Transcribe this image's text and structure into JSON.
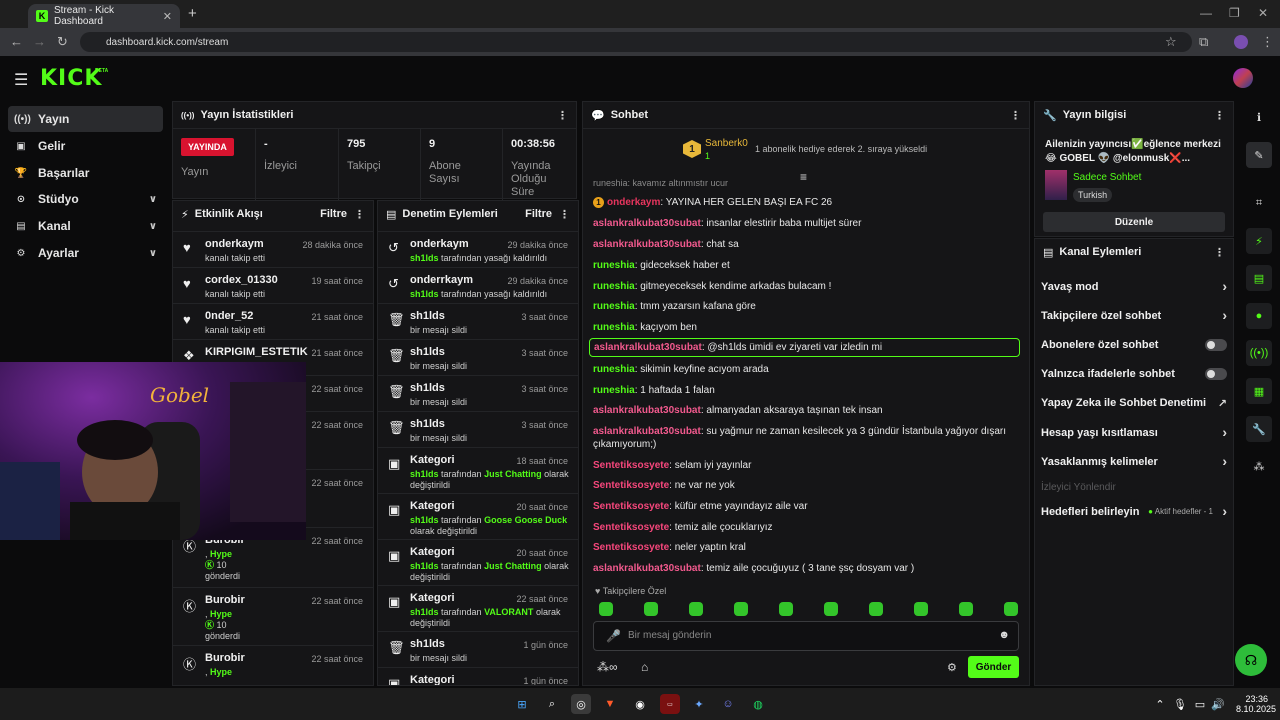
{
  "browser": {
    "tab_title": "Stream - Kick Dashboard",
    "url": "dashboard.kick.com/stream"
  },
  "brand": {
    "name": "KICK",
    "beta": "BETA"
  },
  "nav": [
    {
      "label": "Yayın",
      "icon": "broadcast-icon"
    },
    {
      "label": "Gelir",
      "icon": "revenue-icon"
    },
    {
      "label": "Başarılar",
      "icon": "trophy-icon"
    },
    {
      "label": "Stüdyo",
      "icon": "studio-icon"
    },
    {
      "label": "Kanal",
      "icon": "channel-icon"
    },
    {
      "label": "Ayarlar",
      "icon": "gear-icon"
    }
  ],
  "stats": {
    "title": "Yayın İstatistikleri",
    "live": "YAYINDA",
    "live_label": "Yayın",
    "viewers": "-",
    "viewers_label": "İzleyici",
    "followers": "795",
    "followers_label": "Takipçi",
    "subs": "9",
    "subs_label": "Abone Sayısı",
    "uptime": "00:38:56",
    "uptime_label": "Yayında Olduğu Süre"
  },
  "activity": {
    "title": "Etkinlik Akışı",
    "filter": "Filtre",
    "items": [
      {
        "name": "onderkaym",
        "sub": "kanalı takip etti",
        "time": "28 dakika önce"
      },
      {
        "name": "cordex_01330",
        "sub": "kanalı takip etti",
        "time": "19 saat önce"
      },
      {
        "name": "0nder_52",
        "sub": "kanalı takip etti",
        "time": "21 saat önce"
      },
      {
        "name": "KIRPIGIM_ESTETIK",
        "sub": "",
        "time": "21 saat önce"
      },
      {
        "time": "22 saat önce"
      },
      {
        "time": "22 saat önce"
      },
      {
        "time": "22 saat önce"
      },
      {
        "name": "Burobir",
        "hype": "Hype",
        "amount": "10",
        "sent": "gönderdi",
        "time": "22 saat önce"
      },
      {
        "name": "Burobir",
        "hype": "Hype",
        "amount": "10",
        "sent": "gönderdi",
        "time": "22 saat önce"
      },
      {
        "name": "Burobir",
        "hype": "Hype",
        "time": "22 saat önce"
      }
    ]
  },
  "moderation": {
    "title": "Denetim Eylemleri",
    "filter": "Filtre",
    "items": [
      {
        "name": "onderkaym",
        "mod": "sh1lds",
        "rest": "tarafından yasağı kaldırıldı",
        "time": "29 dakika önce"
      },
      {
        "name": "onderrkaym",
        "mod": "sh1lds",
        "rest": "tarafından yasağı kaldırıldı",
        "time": "29 dakika önce"
      },
      {
        "name": "sh1lds",
        "rest": "bir mesajı sildi",
        "time": "3 saat önce"
      },
      {
        "name": "sh1lds",
        "rest": "bir mesajı sildi",
        "time": "3 saat önce"
      },
      {
        "name": "sh1lds",
        "rest": "bir mesajı sildi",
        "time": "3 saat önce"
      },
      {
        "name": "sh1lds",
        "rest": "bir mesajı sildi",
        "time": "3 saat önce"
      },
      {
        "name": "Kategori",
        "mod": "sh1lds",
        "pre": "tarafından",
        "cat": "Just Chatting",
        "rest": "olarak değiştirildi",
        "time": "18 saat önce"
      },
      {
        "name": "Kategori",
        "mod": "sh1lds",
        "pre": "tarafından",
        "cat": "Goose Goose Duck",
        "rest": "olarak değiştirildi",
        "time": "20 saat önce"
      },
      {
        "name": "Kategori",
        "mod": "sh1lds",
        "pre": "tarafından",
        "cat": "Just Chatting",
        "rest": "olarak değiştirildi",
        "time": "20 saat önce"
      },
      {
        "name": "Kategori",
        "mod": "sh1lds",
        "pre": "tarafından",
        "cat": "VALORANT",
        "rest": "olarak değiştirildi",
        "time": "22 saat önce"
      },
      {
        "name": "sh1lds",
        "rest": "bir mesajı sildi",
        "time": "1 gün önce"
      },
      {
        "name": "Kategori",
        "time": "1 gün önce"
      }
    ]
  },
  "chat": {
    "title": "Sohbet",
    "top_user": "Sanberk0",
    "top_rank": "1",
    "top_count": "1",
    "gift_text": "1 abonelik hediye ederek 2. sıraya yükseldi",
    "cut_line": "runeshia: kayamız altınmıştır ucur",
    "messages": [
      {
        "user": "onderkaym",
        "text": ": YAYINA HER GELEN BAŞI EA FC 26",
        "cls": "u4",
        "badge": "1"
      },
      {
        "user": "aslankralkubat30subat",
        "text": ": insanlar elestirir baba multijet sürer",
        "cls": "u1"
      },
      {
        "user": "aslankralkubat30subat",
        "text": ": chat sa",
        "cls": "u1"
      },
      {
        "user": "runeshia",
        "text": ": gideceksek haber et",
        "cls": "u2"
      },
      {
        "user": "runeshia",
        "text": ": gitmeyeceksek kendime arkadas bulacam !",
        "cls": "u2"
      },
      {
        "user": "runeshia",
        "text": ": tmm yazarsın kafana göre",
        "cls": "u2"
      },
      {
        "user": "runeshia",
        "text": ": kaçıyom ben",
        "cls": "u2"
      },
      {
        "user": "aslankralkubat30subat",
        "text": ": @sh1lds ümidi ev ziyareti var izledin mi",
        "cls": "u1",
        "hl": true
      },
      {
        "user": "runeshia",
        "text": ": sikimin keyfine acıyom arada",
        "cls": "u2"
      },
      {
        "user": "runeshia",
        "text": ": 1 haftada 1 falan",
        "cls": "u2"
      },
      {
        "user": "aslankralkubat30subat",
        "text": ": almanyadan aksaraya taşınan tek insan",
        "cls": "u1"
      },
      {
        "user": "aslankralkubat30subat",
        "text": ": su yağmur ne zaman kesilecek ya 3 gündür İstanbula yağıyor dışarı çıkamıyorum;)",
        "cls": "u1",
        "two": true
      },
      {
        "user": "Sentetiksosyete",
        "text": ": selam iyi yayınlar",
        "cls": "u3"
      },
      {
        "user": "Sentetiksosyete",
        "text": ": ne var ne yok",
        "cls": "u3"
      },
      {
        "user": "Sentetiksosyete",
        "text": ": küfür etme yayındayız aile var",
        "cls": "u3"
      },
      {
        "user": "Sentetiksosyete",
        "text": ": temiz aile çocuklarıyız",
        "cls": "u3"
      },
      {
        "user": "Sentetiksosyete",
        "text": ": neler yaptın kral",
        "cls": "u3"
      },
      {
        "user": "aslankralkubat30subat",
        "text": ": temiz aile çocuğuyuz ( 3 tane şsç dosyam var )",
        "cls": "u1"
      }
    ],
    "follower_label": "Takipçilere Özel",
    "placeholder": "Bir mesaj gönderin",
    "infinity": "∞",
    "send": "Gönder"
  },
  "info": {
    "title": "Yayın bilgisi",
    "stream_title": "Ailenizin yayıncısı✅eğlence merkezi 😂 GOBEL 👽 @elonmusk❌...",
    "category": "Sadece Sohbet",
    "tag": "Turkish",
    "edit": "Düzenle"
  },
  "channel_actions": {
    "title": "Kanal Eylemleri",
    "items": [
      {
        "label": "Yavaş mod",
        "kind": "chev"
      },
      {
        "label": "Takipçilere özel sohbet",
        "kind": "chev"
      },
      {
        "label": "Abonelere özel sohbet",
        "kind": "toggle"
      },
      {
        "label": "Yalnızca ifadelerle sohbet",
        "kind": "toggle"
      },
      {
        "label": "Yapay Zeka ile Sohbet Denetimi",
        "kind": "ext"
      },
      {
        "label": "Hesap yaşı kısıtlaması",
        "kind": "chev"
      },
      {
        "label": "Yasaklanmış kelimeler",
        "kind": "chev"
      },
      {
        "label": "İzleyici Yönlendir",
        "kind": "disabled"
      },
      {
        "label": "Hedefleri belirleyin",
        "kind": "goal",
        "extra": "Aktif hedefler - 1"
      }
    ]
  },
  "taskbar": {
    "time": "23:36",
    "date": "8.10.2025"
  },
  "colors": {
    "accent": "#53fc18",
    "live": "#d8132f"
  }
}
